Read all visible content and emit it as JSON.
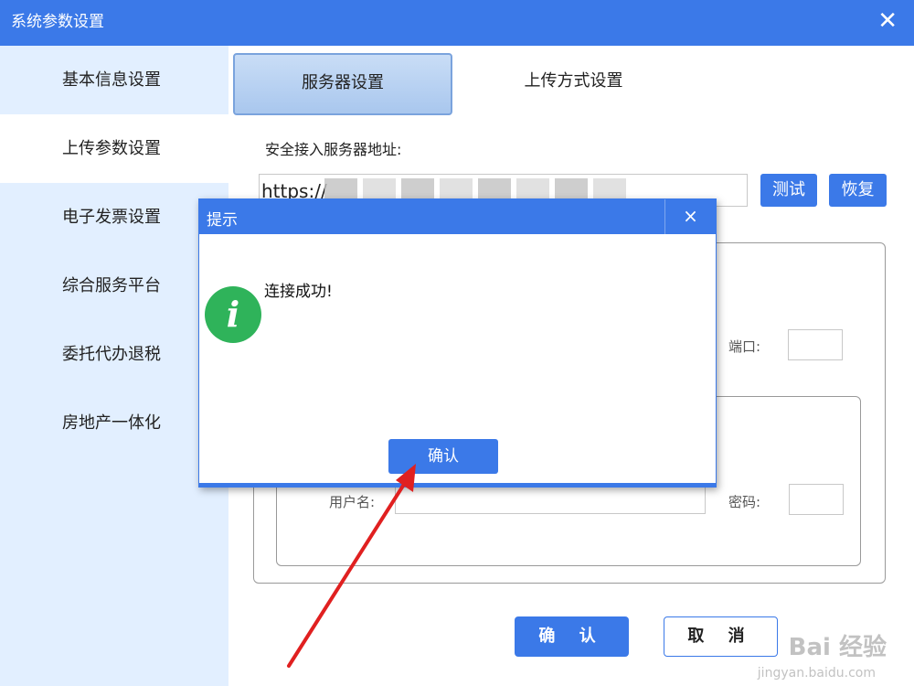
{
  "window": {
    "title": "系统参数设置"
  },
  "sidebar": {
    "items": [
      {
        "label": "基本信息设置"
      },
      {
        "label": "上传参数设置"
      },
      {
        "label": "电子发票设置"
      },
      {
        "label": "综合服务平台"
      },
      {
        "label": "委托代办退税"
      },
      {
        "label": "房地产一体化"
      }
    ]
  },
  "tabs": {
    "server": "服务器设置",
    "upload": "上传方式设置"
  },
  "server": {
    "address_label": "安全接入服务器地址:",
    "address_value": "https://",
    "test_label": "测试",
    "restore_label": "恢复",
    "port_label": "端口:",
    "username_label": "用户名:",
    "password_label": "密码:"
  },
  "footer": {
    "ok_label": "确 认",
    "cancel_label": "取 消"
  },
  "dialog": {
    "title": "提示",
    "close": "×",
    "message": "连接成功!",
    "icon_glyph": "i",
    "ok_label": "确认"
  },
  "watermark": {
    "main": "Bai 经验",
    "sub": "jingyan.baidu.com"
  },
  "colors": {
    "accent": "#3b79e8",
    "sidebar_bg": "#e2efff",
    "info_green": "#2fb35a",
    "annotation_arrow": "#e02020"
  }
}
